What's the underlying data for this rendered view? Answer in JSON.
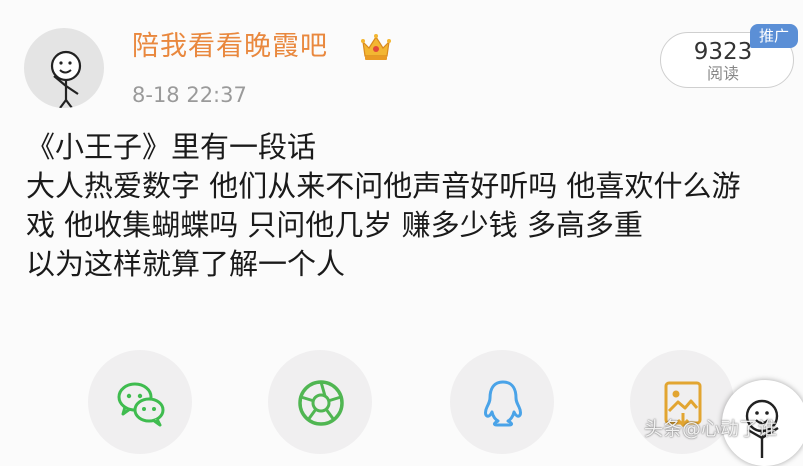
{
  "post": {
    "author": {
      "name": "陪我看看晚霞吧",
      "avatar": "stick-figure-avatar",
      "badge": "crown-icon"
    },
    "timestamp": "8-18 22:37",
    "views": {
      "count": "9323",
      "label": "阅读"
    },
    "promo_tag": "推广",
    "text_lines": [
      "《小王子》里有一段话",
      "大人热爱数字 他们从来不问他声音好听吗 他喜欢什么游",
      "戏 他收集蝴蝶吗 只问他几岁 赚多少钱 多高多重",
      "以为这样就算了解一个人"
    ]
  },
  "share_bar": {
    "buttons": [
      {
        "name": "wechat",
        "icon": "wechat-icon",
        "color": "#3fbc4f"
      },
      {
        "name": "moments",
        "icon": "aperture-icon",
        "color": "#50b652"
      },
      {
        "name": "qq",
        "icon": "qq-penguin-icon",
        "color": "#4aa3e8"
      },
      {
        "name": "save-image",
        "icon": "image-download-icon",
        "color": "#e2a531"
      }
    ]
  },
  "watermark": {
    "text": "头条@心动了谁",
    "avatar": "stick-figure-avatar"
  }
}
